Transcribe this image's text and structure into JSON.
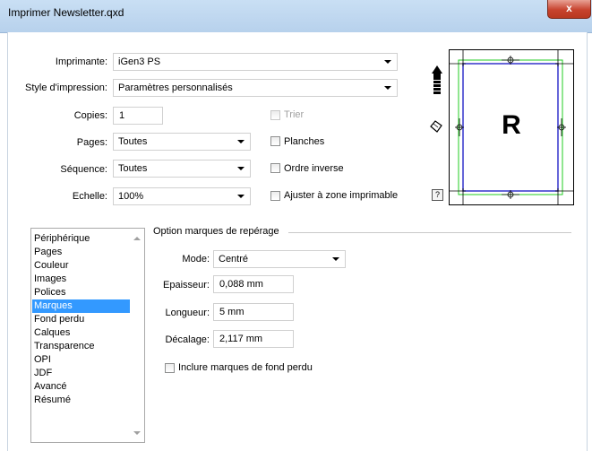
{
  "window": {
    "title": "Imprimer Newsletter.qxd",
    "close_glyph": "x"
  },
  "printer": {
    "label": "Imprimante:",
    "value": "iGen3 PS"
  },
  "print_style": {
    "label": "Style d'impression:",
    "value": "Paramètres personnalisés"
  },
  "copies": {
    "label": "Copies:",
    "value": "1"
  },
  "pages": {
    "label": "Pages:",
    "value": "Toutes"
  },
  "sequence": {
    "label": "Séquence:",
    "value": "Toutes"
  },
  "scale": {
    "label": "Echelle:",
    "value": "100%"
  },
  "checkboxes": {
    "collate": {
      "label": "Trier",
      "checked": false,
      "enabled": false
    },
    "spreads": {
      "label": "Planches",
      "checked": false,
      "enabled": true
    },
    "reverse": {
      "label": "Ordre inverse",
      "checked": false,
      "enabled": true
    },
    "fit": {
      "label": "Ajuster à zone imprimable",
      "checked": false,
      "enabled": true
    }
  },
  "help_glyph": "?",
  "preview": {
    "letter": "R",
    "colors": {
      "page_outline": "#3333cc",
      "bleed": "#22cc22"
    }
  },
  "panes": {
    "items": [
      "Périphérique",
      "Pages",
      "Couleur",
      "Images",
      "Polices",
      "Marques",
      "Fond perdu",
      "Calques",
      "Transparence",
      "OPI",
      "JDF",
      "Avancé",
      "Résumé"
    ],
    "selected_index": 5
  },
  "registration": {
    "section_title": "Option marques de repérage",
    "mode": {
      "label": "Mode:",
      "value": "Centré"
    },
    "thickness": {
      "label": "Epaisseur:",
      "value": "0,088 mm"
    },
    "length": {
      "label": "Longueur:",
      "value": "5 mm"
    },
    "offset": {
      "label": "Décalage:",
      "value": "2,117 mm"
    },
    "include_bleed": {
      "label": "Inclure marques de fond perdu",
      "checked": false
    }
  },
  "colors": {
    "selection": "#3399ff",
    "title_bar": "#c9dff4",
    "close_button": "#c7432e"
  }
}
